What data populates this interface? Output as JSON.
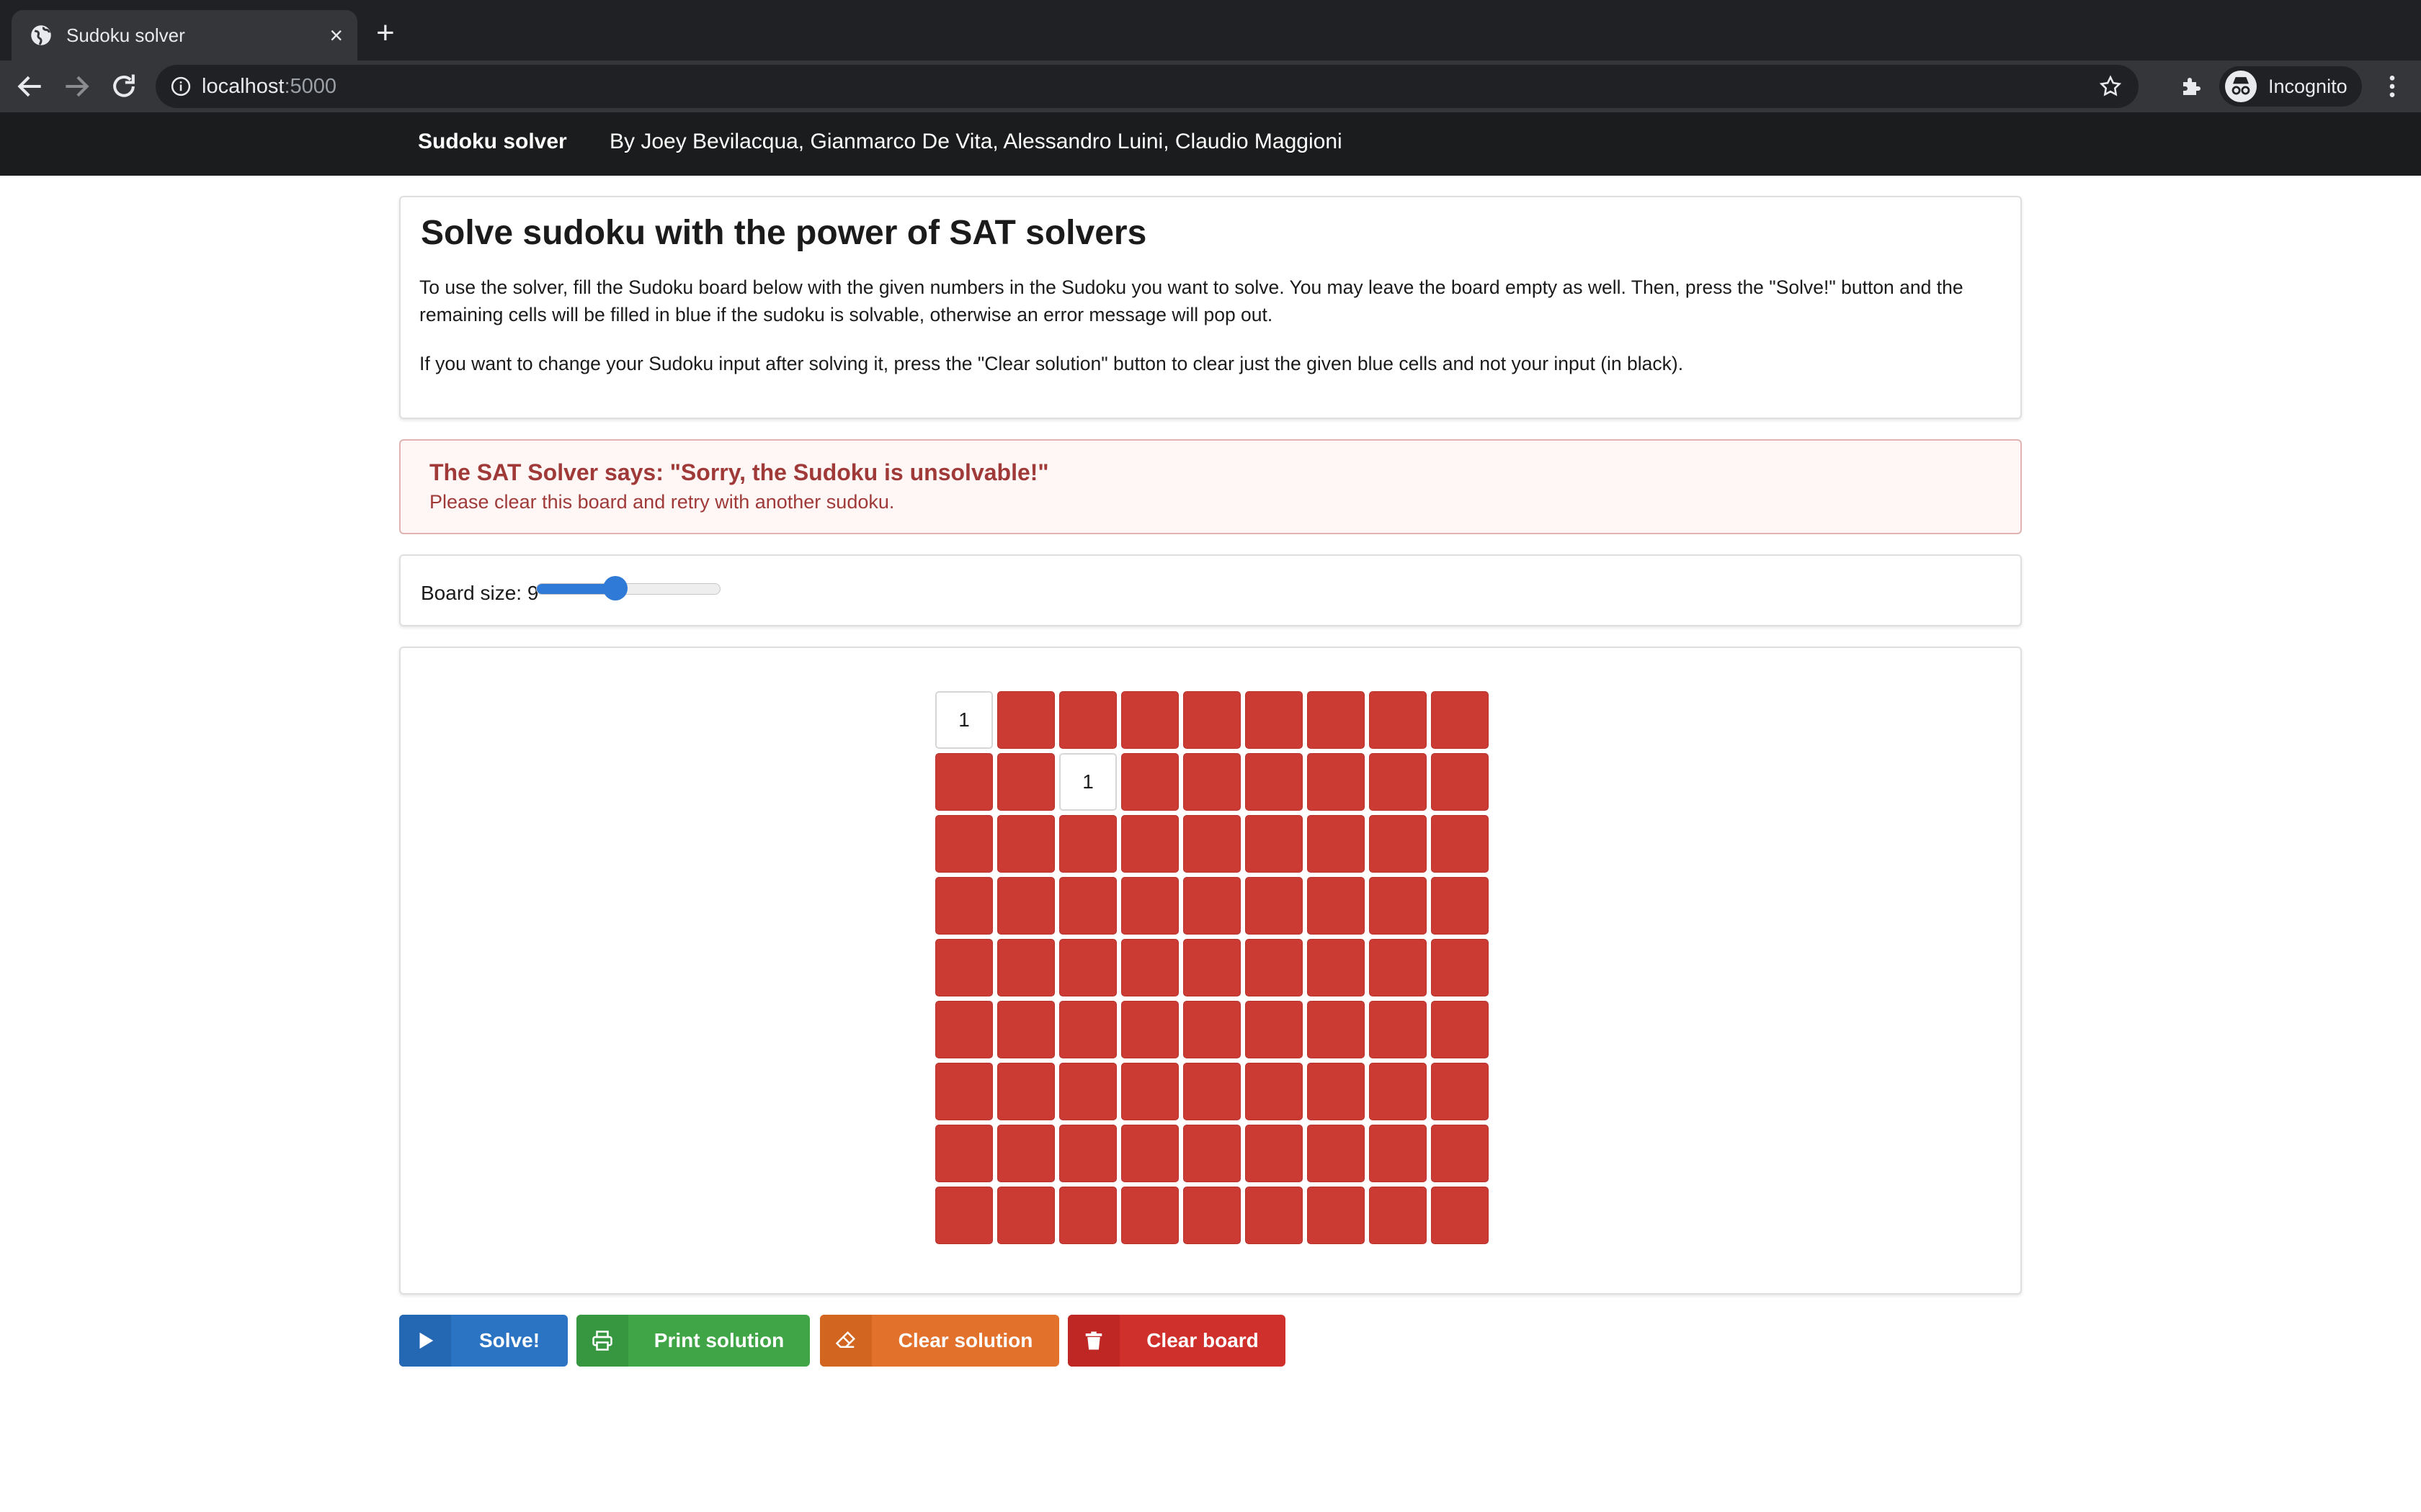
{
  "browser": {
    "tab_title": "Sudoku solver",
    "tab_close": "×",
    "new_tab": "+",
    "url_host": "localhost",
    "url_port": ":5000",
    "profile_label": "Incognito"
  },
  "navbar": {
    "brand": "Sudoku solver",
    "authors": "By Joey Bevilacqua, Gianmarco De Vita, Alessandro Luini, Claudio Maggioni"
  },
  "intro": {
    "title": "Solve sudoku with the power of SAT solvers",
    "paragraph1": "To use the solver, fill the Sudoku board below with the given numbers in the Sudoku you want to solve. You may leave the board empty as well. Then, press the \"Solve!\" button and the remaining cells will be filled in blue if the sudoku is solvable, otherwise an error message will pop out.",
    "paragraph2": "If you want to change your Sudoku input after solving it, press the \"Clear solution\" button to clear just the given blue cells and not your input (in black)."
  },
  "error": {
    "title": "The SAT Solver says: \"Sorry, the Sudoku is unsolvable!\"",
    "message": "Please clear this board and retry with another sudoku."
  },
  "board_size": {
    "label": "Board size: 9",
    "value": 9,
    "min": 4,
    "max": 16
  },
  "board": {
    "size": 9,
    "error_color": "#cc3b33",
    "given_cells": [
      {
        "row": 0,
        "col": 0,
        "value": "1"
      },
      {
        "row": 1,
        "col": 2,
        "value": "1"
      }
    ]
  },
  "buttons": {
    "solve": {
      "label": "Solve!",
      "icon": "play-icon"
    },
    "print": {
      "label": "Print solution",
      "icon": "print-icon"
    },
    "clear_solution": {
      "label": "Clear solution",
      "icon": "eraser-icon"
    },
    "clear_board": {
      "label": "Clear board",
      "icon": "trash-icon"
    }
  },
  "colors": {
    "solve": "#2b74c4",
    "print": "#3fa547",
    "clear_solution": "#e2712c",
    "clear_board": "#d0302c",
    "error_text": "#9f3a38"
  }
}
